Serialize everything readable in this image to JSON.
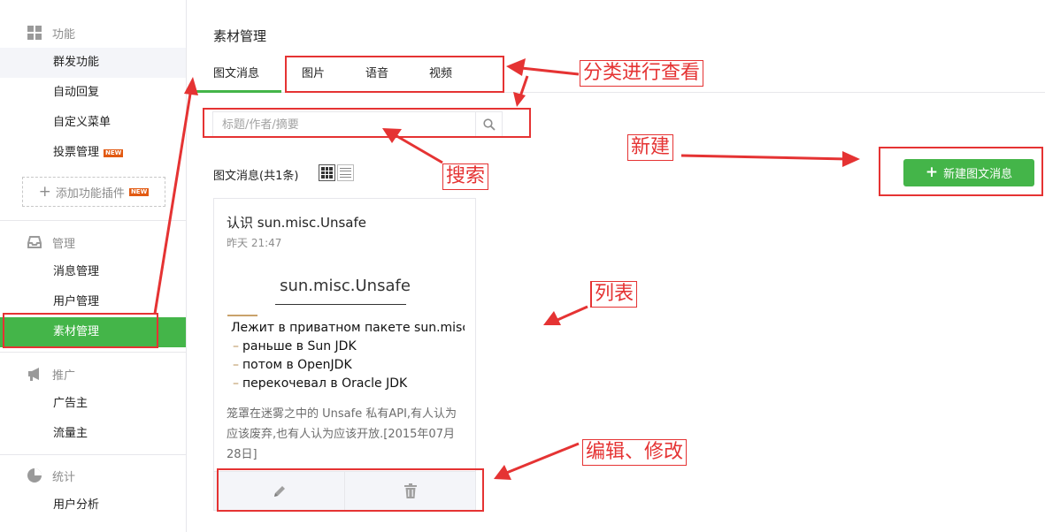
{
  "sidebar": {
    "groups": [
      {
        "label": "功能",
        "icon": "grid-icon"
      },
      {
        "label": "管理",
        "icon": "inbox-icon"
      },
      {
        "label": "推广",
        "icon": "megaphone-icon"
      },
      {
        "label": "统计",
        "icon": "pie-chart-icon"
      }
    ],
    "items": [
      {
        "label": "群发功能"
      },
      {
        "label": "自动回复"
      },
      {
        "label": "自定义菜单"
      },
      {
        "label": "投票管理",
        "badge": "NEW"
      },
      {
        "label": "消息管理"
      },
      {
        "label": "用户管理"
      },
      {
        "label": "素材管理",
        "active": true
      },
      {
        "label": "广告主"
      },
      {
        "label": "流量主"
      },
      {
        "label": "用户分析"
      }
    ],
    "add_plugin": {
      "label": "添加功能插件",
      "badge": "NEW"
    }
  },
  "main": {
    "title": "素材管理",
    "tabs": [
      {
        "label": "图文消息",
        "active": true
      },
      {
        "label": "图片"
      },
      {
        "label": "语音"
      },
      {
        "label": "视频"
      }
    ],
    "search": {
      "placeholder": "标题/作者/摘要",
      "value": ""
    },
    "count_label": "图文消息(共1条)",
    "new_button": "新建图文消息",
    "card": {
      "title": "认识 sun.misc.Unsafe",
      "time": "昨天 21:47",
      "cover": {
        "title": "sun.misc.Unsafe",
        "lines": [
          "Лежит в приватном пакете sun.misc",
          "раньше в Sun JDK",
          "потом в OpenJDK",
          "перекочевал в Oracle JDK"
        ]
      },
      "description": "笼罩在迷雾之中的 Unsafe 私有API,有人认为应该废弃,也有人认为应该开放.[2015年07月28日]",
      "actions": [
        {
          "icon": "pencil-icon"
        },
        {
          "icon": "trash-icon"
        }
      ]
    }
  },
  "annotations": {
    "classify": "分类进行查看",
    "search": "搜索",
    "new": "新建",
    "list": "列表",
    "edit": "编辑、修改"
  },
  "colors": {
    "accent": "#44b549",
    "annotation": "#e53333",
    "border": "#e7e7eb"
  }
}
